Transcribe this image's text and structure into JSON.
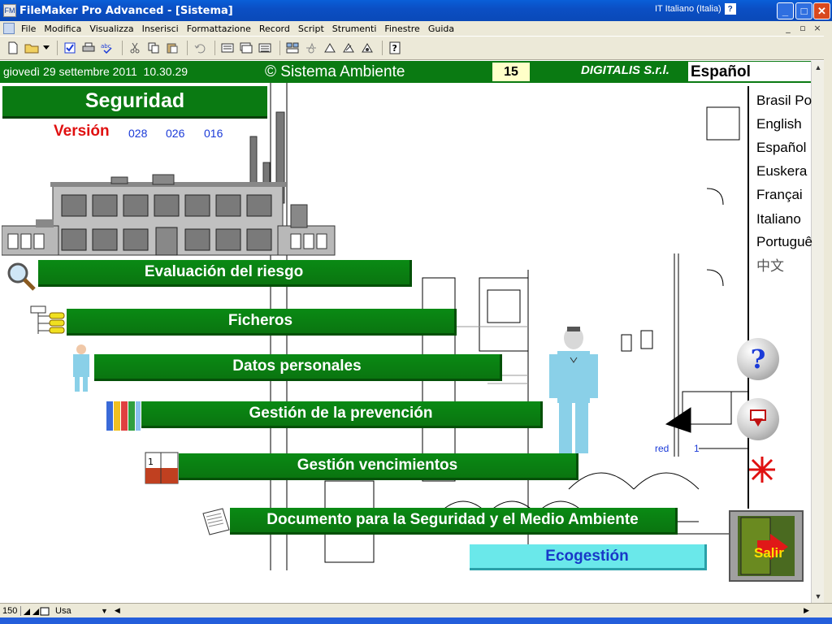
{
  "window": {
    "title": "FileMaker Pro Advanced - [Sistema]",
    "app_icon_glyph": "FM",
    "language_indicator": "IT Italiano (Italia)",
    "help_glyph": "?",
    "minimize_glyph": "_",
    "maximize_glyph": "□",
    "close_glyph": "✕"
  },
  "menu": {
    "items": [
      "File",
      "Modifica",
      "Visualizza",
      "Inserisci",
      "Formattazione",
      "Record",
      "Script",
      "Strumenti",
      "Finestre",
      "Guida"
    ],
    "mdi_min": "_",
    "mdi_restore": "▫",
    "mdi_close": "×"
  },
  "header": {
    "date": "giovedì 29 settembre 2011",
    "time": "10.30.29",
    "company": "© Sistema Ambiente",
    "badge": "15",
    "brand": "DIGITALIS S.r.l.",
    "current_language": "Español"
  },
  "section": {
    "title": "Seguridad",
    "version_label": "Versión",
    "versions": [
      "028",
      "026",
      "016"
    ]
  },
  "buttons": {
    "risk": "Evaluación del riesgo",
    "files": "Ficheros",
    "personal": "Datos personales",
    "prevention": "Gestión de la prevención",
    "expiry": "Gestión vencimientos",
    "document": "Documento para la Seguridad y el Medio Ambiente",
    "eco": "Ecogestión",
    "exit": "Salir"
  },
  "languages": [
    "Brasil Po",
    "English",
    "Español",
    "Euskera",
    "Françai",
    "Italiano",
    "Portuguê",
    "中文"
  ],
  "overlay_labels": {
    "red": "red",
    "one": "1",
    "help_q": "?"
  },
  "status": {
    "zoom": "150",
    "mode": "Usa"
  },
  "colors": {
    "accent_green": "#0a7a12",
    "eco_cyan": "#6ae8ea",
    "version_red": "#e01010"
  }
}
